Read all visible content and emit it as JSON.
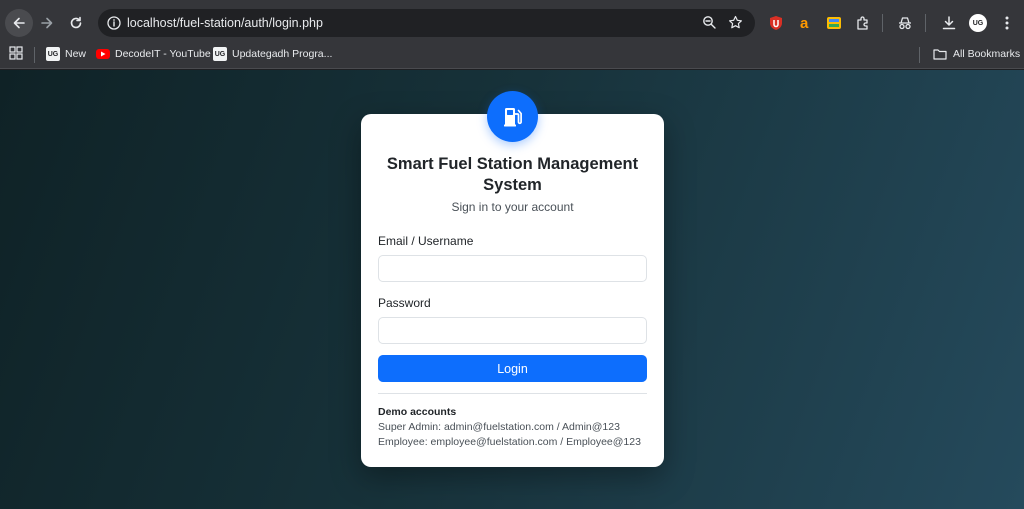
{
  "browser": {
    "url": "localhost/fuel-station/auth/login.php",
    "profile_initials": "UG",
    "colors": {
      "toolbar": "#35363a",
      "omnibox": "#202124"
    }
  },
  "bookmarks": {
    "items": [
      {
        "label": "New",
        "icon": "uc-favicon"
      },
      {
        "label": "DecodeIT - YouTube",
        "icon": "youtube-favicon"
      },
      {
        "label": "Updategadh Progra...",
        "icon": "uc-favicon"
      }
    ],
    "all_bookmarks": "All Bookmarks"
  },
  "login": {
    "logo_icon": "gas-pump-icon",
    "title": "Smart Fuel Station Management System",
    "subtitle": "Sign in to your account",
    "email_label": "Email / Username",
    "email_value": "",
    "password_label": "Password",
    "password_value": "",
    "submit_label": "Login",
    "demo_title": "Demo accounts",
    "demo_super_admin": "Super Admin: admin@fuelstation.com / Admin@123",
    "demo_employee": "Employee: employee@fuelstation.com / Employee@123",
    "colors": {
      "primary": "#0d6efd",
      "card": "#ffffff"
    }
  }
}
